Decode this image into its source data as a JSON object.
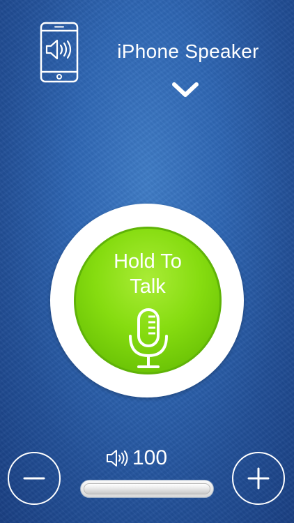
{
  "output": {
    "device_label": "iPhone Speaker",
    "device_icon": "phone-speaker-icon",
    "dropdown_icon": "chevron-down-icon"
  },
  "talk": {
    "line1": "Hold To",
    "line2": "Talk",
    "icon": "microphone-icon"
  },
  "volume": {
    "value": "100",
    "level_fraction": 1.0,
    "icon": "speaker-icon",
    "decrease_icon": "minus-icon",
    "increase_icon": "plus-icon"
  },
  "colors": {
    "background": "#2f67b4",
    "talk_green": "#86dc10",
    "ring": "#ffffff"
  }
}
